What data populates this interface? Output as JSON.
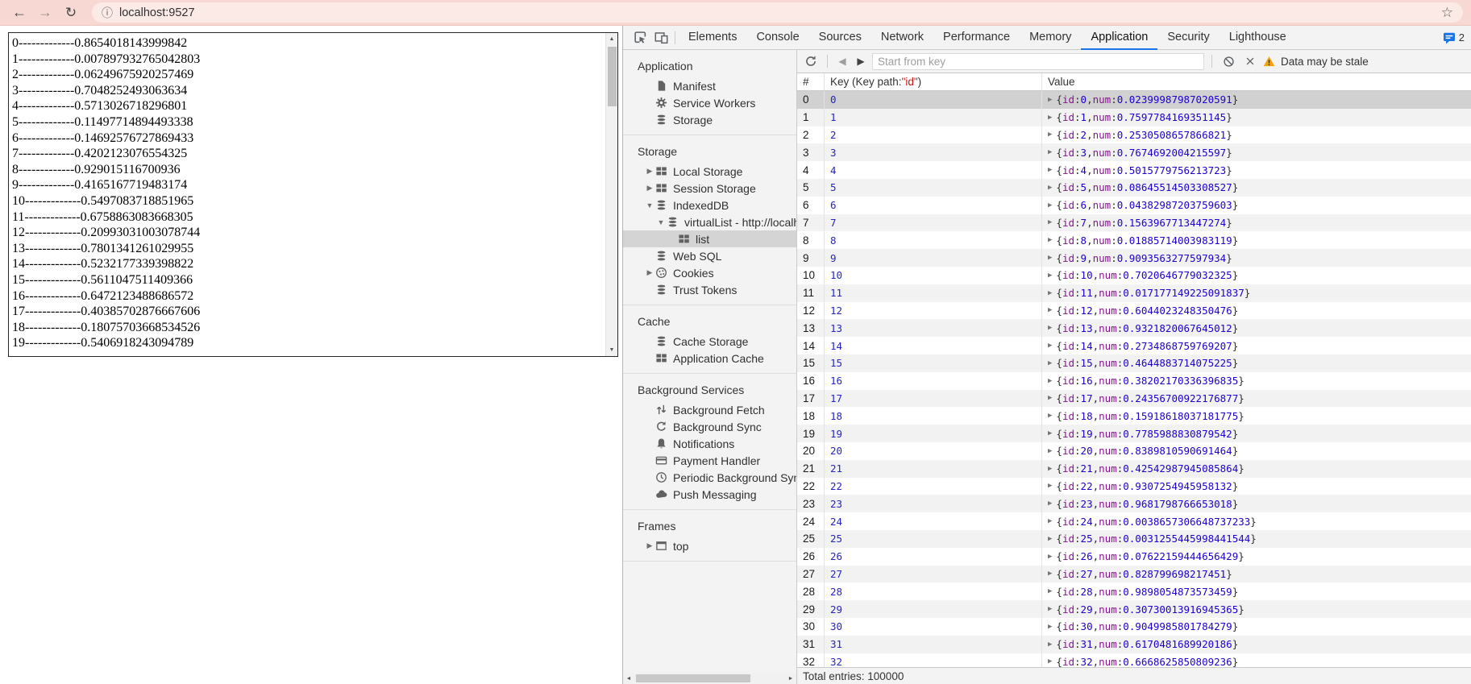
{
  "browser": {
    "url": "localhost:9527",
    "icons": {
      "back": "←",
      "forward": "→",
      "reload": "↻",
      "info": "ⓘ",
      "star": "☆"
    }
  },
  "page": {
    "dashes": "-------------",
    "rows": [
      {
        "i": "0",
        "v": "0.8654018143999842"
      },
      {
        "i": "1",
        "v": "0.007897932765042803"
      },
      {
        "i": "2",
        "v": "0.06249675920257469"
      },
      {
        "i": "3",
        "v": "0.7048252493063634"
      },
      {
        "i": "4",
        "v": "0.5713026718296801"
      },
      {
        "i": "5",
        "v": "0.11497714894493338"
      },
      {
        "i": "6",
        "v": "0.14692576727869433"
      },
      {
        "i": "7",
        "v": "0.4202123076554325"
      },
      {
        "i": "8",
        "v": "0.929015116700936"
      },
      {
        "i": "9",
        "v": "0.4165167719483174"
      },
      {
        "i": "10",
        "v": "0.5497083718851965"
      },
      {
        "i": "11",
        "v": "0.6758863083668305"
      },
      {
        "i": "12",
        "v": "0.20993031003078744"
      },
      {
        "i": "13",
        "v": "0.7801341261029955"
      },
      {
        "i": "14",
        "v": "0.5232177339398822"
      },
      {
        "i": "15",
        "v": "0.5611047511409366"
      },
      {
        "i": "16",
        "v": "0.6472123488686572"
      },
      {
        "i": "17",
        "v": "0.40385702876667606"
      },
      {
        "i": "18",
        "v": "0.18075703668534526"
      },
      {
        "i": "19",
        "v": "0.5406918243094789"
      }
    ],
    "scroll_glyphs": {
      "up": "▲",
      "down": "▼",
      "left": "◄",
      "right": "►"
    }
  },
  "devtools": {
    "tabs": [
      "Elements",
      "Console",
      "Sources",
      "Network",
      "Performance",
      "Memory",
      "Application",
      "Security",
      "Lighthouse"
    ],
    "active_tab": "Application",
    "message_count": "2",
    "sidebar": {
      "glyphs": {
        "expanded": "▼",
        "collapsed": "▶"
      },
      "sections": [
        {
          "title": "Application",
          "items": [
            {
              "label": "Manifest",
              "icon": "doc"
            },
            {
              "label": "Service Workers",
              "icon": "gear"
            },
            {
              "label": "Storage",
              "icon": "db"
            }
          ]
        },
        {
          "title": "Storage",
          "items": [
            {
              "label": "Local Storage",
              "icon": "table",
              "arrow": "collapsed"
            },
            {
              "label": "Session Storage",
              "icon": "table",
              "arrow": "collapsed"
            },
            {
              "label": "IndexedDB",
              "icon": "db",
              "arrow": "expanded"
            },
            {
              "label": "virtualList - http://localhost",
              "icon": "db",
              "arrow": "expanded",
              "indent": 1
            },
            {
              "label": "list",
              "icon": "table",
              "indent": 2,
              "selected": true
            },
            {
              "label": "Web SQL",
              "icon": "db"
            },
            {
              "label": "Cookies",
              "icon": "cookie",
              "arrow": "collapsed"
            },
            {
              "label": "Trust Tokens",
              "icon": "db"
            }
          ]
        },
        {
          "title": "Cache",
          "items": [
            {
              "label": "Cache Storage",
              "icon": "db"
            },
            {
              "label": "Application Cache",
              "icon": "table"
            }
          ]
        },
        {
          "title": "Background Services",
          "items": [
            {
              "label": "Background Fetch",
              "icon": "updown"
            },
            {
              "label": "Background Sync",
              "icon": "sync"
            },
            {
              "label": "Notifications",
              "icon": "bell"
            },
            {
              "label": "Payment Handler",
              "icon": "card"
            },
            {
              "label": "Periodic Background Sync",
              "icon": "clock"
            },
            {
              "label": "Push Messaging",
              "icon": "cloud"
            }
          ]
        },
        {
          "title": "Frames",
          "items": [
            {
              "label": "top",
              "icon": "frame",
              "arrow": "collapsed"
            }
          ]
        }
      ]
    },
    "toolbar": {
      "search_placeholder": "Start from key",
      "prev_glyph": "◀",
      "next_glyph": "▶",
      "stale_warning": "Data may be stale"
    },
    "grid": {
      "header": {
        "num": "#",
        "key_prefix": "Key (Key path: ",
        "key_path": "\"id\"",
        "key_suffix": ")",
        "value": "Value"
      },
      "preview": {
        "arrow": "▶",
        "open": "{",
        "prop_id": "id",
        "colon": ": ",
        "sep": ", ",
        "prop_num": "num",
        "close": "}"
      },
      "selected_row_index": 0,
      "rows": [
        {
          "n": "0",
          "key": "0",
          "id": "0",
          "num": "0.02399987987020591"
        },
        {
          "n": "1",
          "key": "1",
          "id": "1",
          "num": "0.7597784169351145"
        },
        {
          "n": "2",
          "key": "2",
          "id": "2",
          "num": "0.2530508657866821"
        },
        {
          "n": "3",
          "key": "3",
          "id": "3",
          "num": "0.7674692004215597"
        },
        {
          "n": "4",
          "key": "4",
          "id": "4",
          "num": "0.5015779756213723"
        },
        {
          "n": "5",
          "key": "5",
          "id": "5",
          "num": "0.08645514503308527"
        },
        {
          "n": "6",
          "key": "6",
          "id": "6",
          "num": "0.04382987203759603"
        },
        {
          "n": "7",
          "key": "7",
          "id": "7",
          "num": "0.1563967713447274"
        },
        {
          "n": "8",
          "key": "8",
          "id": "8",
          "num": "0.01885714003983119"
        },
        {
          "n": "9",
          "key": "9",
          "id": "9",
          "num": "0.9093563277597934"
        },
        {
          "n": "10",
          "key": "10",
          "id": "10",
          "num": "0.7020646779032325"
        },
        {
          "n": "11",
          "key": "11",
          "id": "11",
          "num": "0.017177149225091837"
        },
        {
          "n": "12",
          "key": "12",
          "id": "12",
          "num": "0.6044023248350476"
        },
        {
          "n": "13",
          "key": "13",
          "id": "13",
          "num": "0.9321820067645012"
        },
        {
          "n": "14",
          "key": "14",
          "id": "14",
          "num": "0.2734868759769207"
        },
        {
          "n": "15",
          "key": "15",
          "id": "15",
          "num": "0.4644883714075225"
        },
        {
          "n": "16",
          "key": "16",
          "id": "16",
          "num": "0.38202170336396835"
        },
        {
          "n": "17",
          "key": "17",
          "id": "17",
          "num": "0.24356700922176877"
        },
        {
          "n": "18",
          "key": "18",
          "id": "18",
          "num": "0.15918618037181775"
        },
        {
          "n": "19",
          "key": "19",
          "id": "19",
          "num": "0.7785988830879542"
        },
        {
          "n": "20",
          "key": "20",
          "id": "20",
          "num": "0.8389810590691464"
        },
        {
          "n": "21",
          "key": "21",
          "id": "21",
          "num": "0.42542987945085864"
        },
        {
          "n": "22",
          "key": "22",
          "id": "22",
          "num": "0.9307254945958132"
        },
        {
          "n": "23",
          "key": "23",
          "id": "23",
          "num": "0.9681798766653018"
        },
        {
          "n": "24",
          "key": "24",
          "id": "24",
          "num": "0.0038657306648737233"
        },
        {
          "n": "25",
          "key": "25",
          "id": "25",
          "num": "0.0031255445998441544"
        },
        {
          "n": "26",
          "key": "26",
          "id": "26",
          "num": "0.07622159444656429"
        },
        {
          "n": "27",
          "key": "27",
          "id": "27",
          "num": "0.828799698217451"
        },
        {
          "n": "28",
          "key": "28",
          "id": "28",
          "num": "0.9898054873573459"
        },
        {
          "n": "29",
          "key": "29",
          "id": "29",
          "num": "0.30730013916945365"
        },
        {
          "n": "30",
          "key": "30",
          "id": "30",
          "num": "0.9049985801784279"
        },
        {
          "n": "31",
          "key": "31",
          "id": "31",
          "num": "0.6170481689920186"
        },
        {
          "n": "32",
          "key": "32",
          "id": "32",
          "num": "0.6668625850809236"
        }
      ]
    },
    "status": "Total entries: 100000"
  }
}
